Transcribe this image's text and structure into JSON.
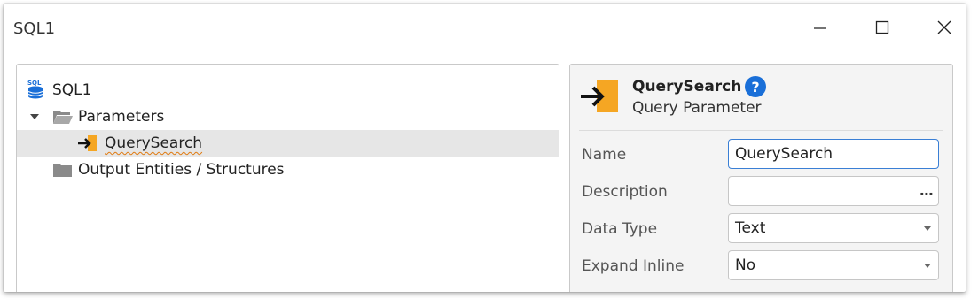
{
  "window": {
    "title": "SQL1"
  },
  "tree": {
    "root": {
      "label": "SQL1",
      "icon": "sql-database-icon"
    },
    "items": [
      {
        "label": "Parameters",
        "icon": "folder-open-icon",
        "expanded": true
      },
      {
        "label": "QuerySearch",
        "icon": "input-parameter-icon",
        "selected": true
      },
      {
        "label": "Output Entities / Structures",
        "icon": "folder-icon"
      }
    ]
  },
  "properties": {
    "name": "QuerySearch",
    "kind": "Query Parameter",
    "help_label": "?",
    "fields": [
      {
        "label": "Name",
        "value": "QuerySearch",
        "type": "text"
      },
      {
        "label": "Description",
        "value": "",
        "type": "text-ellipsis",
        "button": "..."
      },
      {
        "label": "Data Type",
        "value": "Text",
        "type": "dropdown"
      },
      {
        "label": "Expand Inline",
        "value": "No",
        "type": "dropdown"
      }
    ]
  },
  "colors": {
    "accent": "#1a6fd8",
    "param_icon": "#f5a623",
    "selected_row": "#e6e6e6",
    "folder": "#8a8a8a"
  }
}
